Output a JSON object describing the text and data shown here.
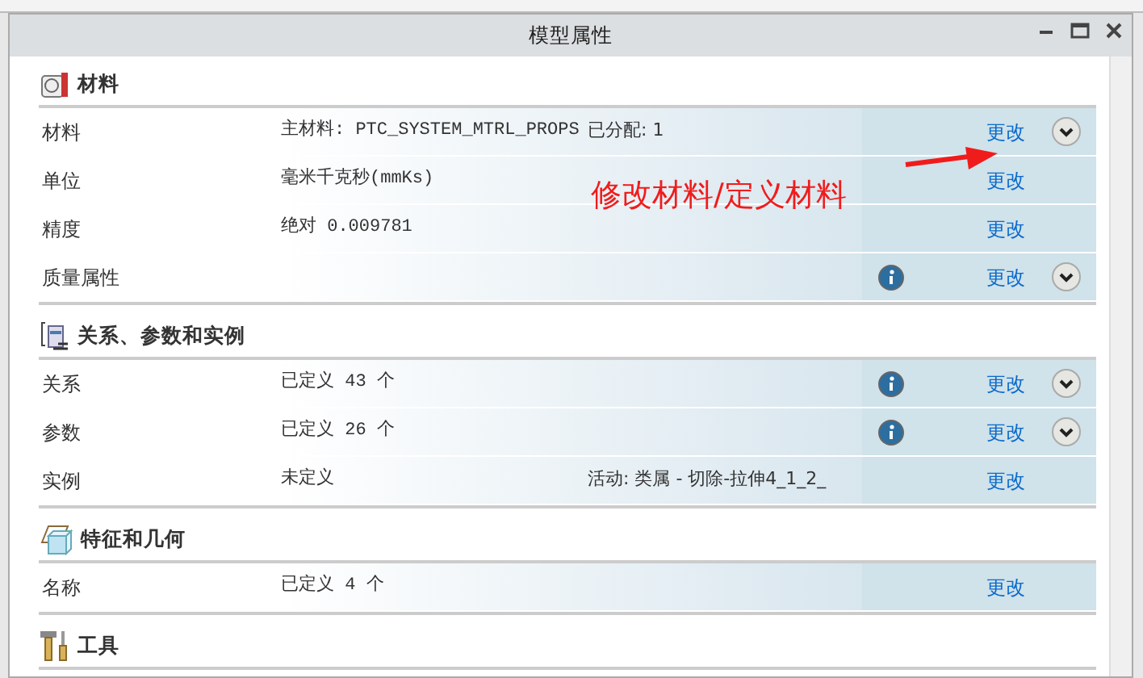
{
  "window": {
    "title": "模型属性"
  },
  "sections": [
    {
      "title": "材料",
      "rows": [
        {
          "label": "材料",
          "value": "主材料: PTC_SYSTEM_MTRL_PROPS",
          "value_2": "已分配: 1",
          "info": false,
          "link": "更改",
          "expandable": true
        },
        {
          "label": "单位",
          "value": "毫米千克秒(mmKs)",
          "info": false,
          "link": "更改",
          "expandable": false
        },
        {
          "label": "精度",
          "value": "绝对 0.009781",
          "info": false,
          "link": "更改",
          "expandable": false
        },
        {
          "label": "质量属性",
          "info": true,
          "link": "更改",
          "expandable": true
        }
      ]
    },
    {
      "title": "关系、参数和实例",
      "rows": [
        {
          "label": "关系",
          "value": "已定义 43 个",
          "info": true,
          "link": "更改",
          "expandable": true
        },
        {
          "label": "参数",
          "value": "已定义 26 个",
          "info": true,
          "link": "更改",
          "expandable": true
        },
        {
          "label": "实例",
          "value": "未定义",
          "value_2": "活动: 类属 - 切除-拉伸4_1_2_",
          "info": false,
          "link": "更改",
          "expandable": false
        }
      ]
    },
    {
      "title": "特征和几何",
      "rows": [
        {
          "label": "名称",
          "value": "已定义 4 个",
          "info": false,
          "link": "更改",
          "expandable": false
        }
      ]
    },
    {
      "title": "工具"
    }
  ],
  "annotation": {
    "text": "修改材料/定义材料"
  }
}
